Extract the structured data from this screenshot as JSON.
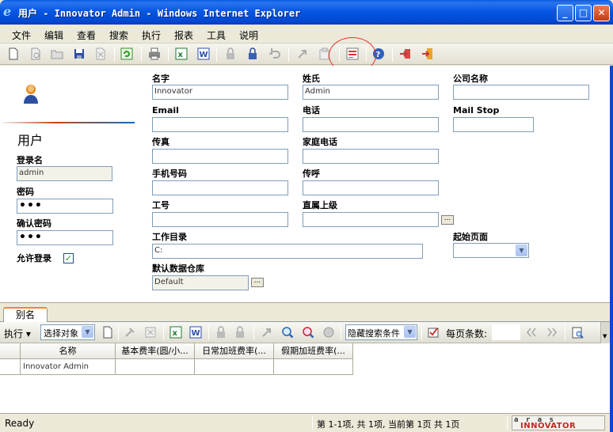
{
  "window": {
    "title": "用户 - Innovator Admin - Windows Internet Explorer"
  },
  "menu": [
    "文件",
    "编辑",
    "查看",
    "搜索",
    "执行",
    "报表",
    "工具",
    "说明"
  ],
  "form": {
    "heading": "用户",
    "login_name_label": "登录名",
    "login_name_value": "admin",
    "password_label": "密码",
    "password_value": "•••",
    "confirm_password_label": "确认密码",
    "confirm_password_value": "•••",
    "allow_login_label": "允许登录",
    "allow_login_checked": "✓",
    "first_name_label": "名字",
    "first_name_value": "Innovator",
    "last_name_label": "姓氏",
    "last_name_value": "Admin",
    "company_label": "公司名称",
    "company_value": "",
    "email_label": "Email",
    "email_value": "",
    "phone_label": "电话",
    "phone_value": "",
    "mailstop_label": "Mail Stop",
    "mailstop_value": "",
    "fax_label": "传真",
    "fax_value": "",
    "home_phone_label": "家庭电话",
    "home_phone_value": "",
    "mobile_label": "手机号码",
    "mobile_value": "",
    "pager_label": "传呼",
    "pager_value": "",
    "employee_id_label": "工号",
    "employee_id_value": "",
    "manager_label": "直属上级",
    "manager_value": "",
    "working_dir_label": "工作目录",
    "working_dir_value": "C:",
    "start_page_label": "起始页面",
    "start_page_value": "",
    "default_vault_label": "默认数据仓库",
    "default_vault_value": "Default",
    "ellipsis": "..."
  },
  "relationships": {
    "tab_label": "别名",
    "toolbar": {
      "execute_label": "执行 ▾",
      "select_label": "选择对象",
      "hide_search_label": "隐藏搜索条件",
      "page_size_label": "每页条数:"
    },
    "columns": [
      "名称",
      "基本费率(圆/小...",
      "日常加班费率(...",
      "假期加班费率(..."
    ],
    "rows": [
      [
        "Innovator Admin",
        "",
        "",
        ""
      ]
    ]
  },
  "status": {
    "ready": "Ready",
    "paging": "第 1-1项, 共 1项, 当前第 1页 共 1页",
    "brand_top": "a r a s",
    "brand_bottom": "INNOVATOR"
  },
  "colors": {
    "titlebar": "#0557e3",
    "accent_ring": "#e0302a",
    "brand": "#c0291e"
  },
  "icons": [
    "new-icon",
    "preview-icon",
    "open-icon",
    "save-icon",
    "close-doc-icon",
    "refresh-icon",
    "print-icon",
    "excel-icon",
    "word-icon",
    "lock-icon",
    "unlock-icon",
    "undo-icon",
    "promote-icon",
    "version-icon",
    "report-icon",
    "help-icon",
    "logout-icon",
    "exit-icon"
  ]
}
